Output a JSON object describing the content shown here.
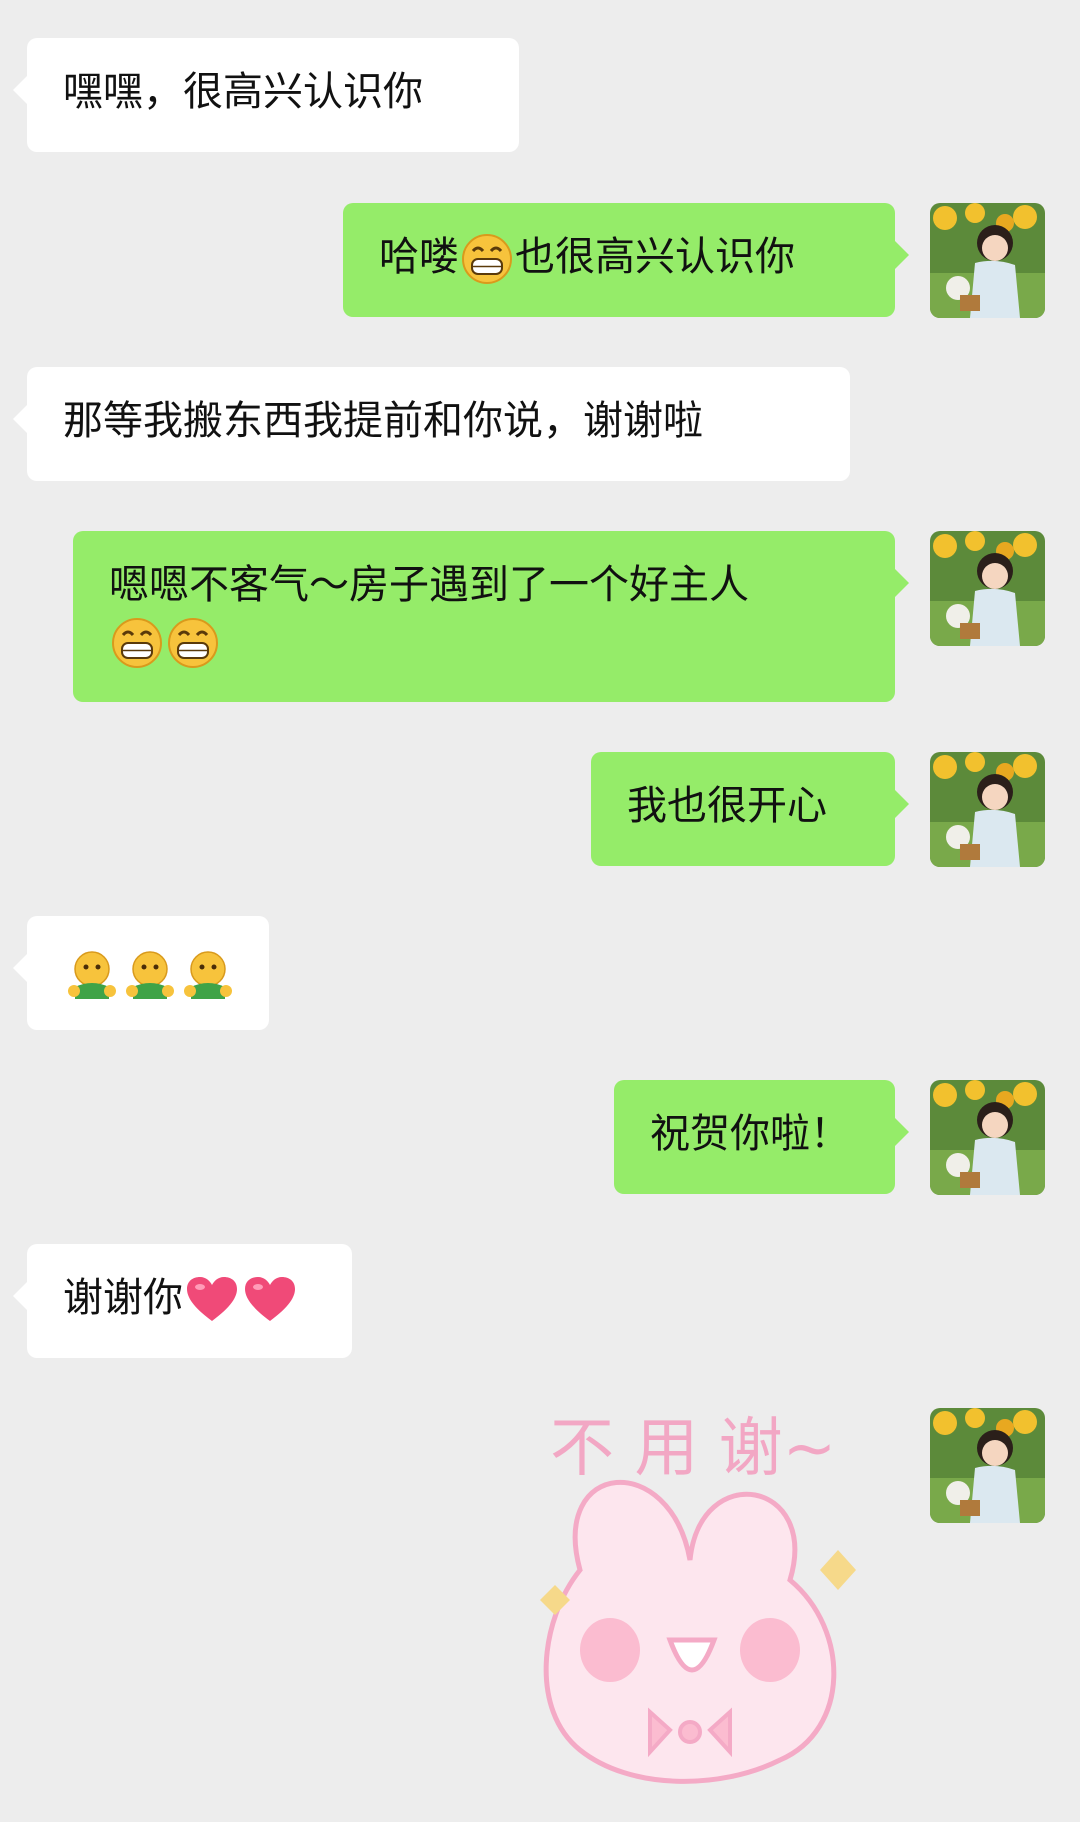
{
  "messages": [
    {
      "side": "in",
      "text_before": "嘿嘿，很高兴认识你",
      "text_after": ""
    },
    {
      "side": "out",
      "text_before": "哈喽",
      "emoji": "grin",
      "text_after": "也很高兴认识你"
    },
    {
      "side": "in",
      "text_before": "那等我搬东西我提前和你说，谢谢啦"
    },
    {
      "side": "out",
      "line1": "嗯嗯不客气～房子遇到了一个好主人",
      "line2_emoji": [
        "grin",
        "grin"
      ]
    },
    {
      "side": "out",
      "text_before": "我也很开心"
    },
    {
      "side": "in",
      "emoji_row": [
        "hug",
        "hug",
        "hug"
      ]
    },
    {
      "side": "out",
      "text_before": "祝贺你啦！"
    },
    {
      "side": "in",
      "text_before": "谢谢你",
      "emoji_row": [
        "heart",
        "heart"
      ]
    },
    {
      "side": "out",
      "sticker_text": "不 用 谢~"
    }
  ],
  "colors": {
    "background": "#ededed",
    "incoming_bubble": "#ffffff",
    "outgoing_bubble": "#95ec69"
  },
  "icons": {
    "grin": "grinning-face-emoji",
    "hug": "hugging-face-emoji",
    "heart": "heart-emoji",
    "avatar": "avatar-girl-sunflowers"
  }
}
